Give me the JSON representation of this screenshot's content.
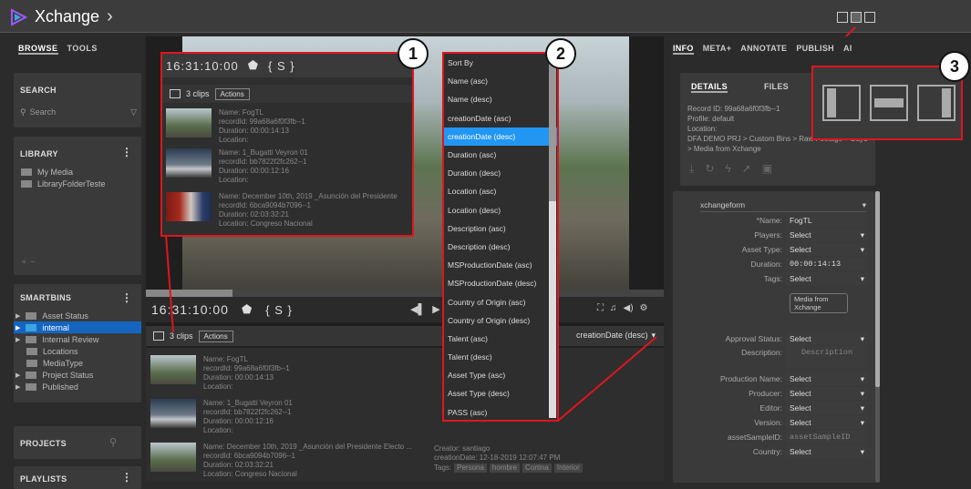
{
  "app": {
    "title": "Xchange"
  },
  "left": {
    "tabs": [
      "BROWSE",
      "TOOLS"
    ],
    "search": {
      "title": "SEARCH",
      "placeholder": "Search"
    },
    "library": {
      "title": "LIBRARY",
      "items": [
        "My Media",
        "LibraryFolderTeste"
      ]
    },
    "smartbins": {
      "title": "SMARTBINS",
      "items": [
        "Asset Status",
        "internal",
        "Internal Review",
        "Locations",
        "MediaType",
        "Project Status",
        "Published"
      ]
    },
    "projects": {
      "title": "PROJECTS"
    },
    "playlists": {
      "title": "PLAYLISTS"
    }
  },
  "player": {
    "timecode": "16:31:10:00",
    "controls": "{ S }"
  },
  "clips": {
    "count": "3 clips",
    "actions": "Actions",
    "sort": "creationDate (desc)",
    "items": [
      {
        "name": "Name: FogTL",
        "id": "recordId: 99a68a6f0f3fb--1",
        "duration": "Duration: 00:00:14:13",
        "location": "Location:"
      },
      {
        "name": "Name: 1_Bugatti Veyron 01",
        "id": "recordId: bb7822f2fc262--1",
        "duration": "Duration: 00:00:12:16",
        "location": "Location:"
      },
      {
        "name": "Name: December 10th, 2019 _Asunción del Presidente Electo ...",
        "id": "recordId: 6bca9094b7096--1",
        "duration": "Duration: 02:03:32:21",
        "location": "Location: Congreso Nacional"
      }
    ],
    "third_meta": {
      "creator": "Creator: santiago",
      "created": "creationDate: 12-18-2019 12:07:47 PM",
      "tags_label": "Tags:",
      "tags": [
        "Persona",
        "hombre",
        "Cortina",
        "Interior"
      ]
    }
  },
  "popup_clips": {
    "items": [
      {
        "name": "Name: FogTL",
        "id": "recordId: 99a68a6f0f3fb--1",
        "duration": "Duration: 00:00:14:13",
        "location": "Location:"
      },
      {
        "name": "Name: 1_Bugatti Veyron 01",
        "id": "recordId: bb7822f2fc262--1",
        "duration": "Duration: 00:00:12:16",
        "location": "Location:"
      },
      {
        "name": "Name: December 10th, 2019 _Asunción del Presidente",
        "id": "recordId: 6bca9094b7096--1",
        "duration": "Duration: 02:03:32:21",
        "location": "Location: Congreso Nacional"
      }
    ]
  },
  "sort_options": [
    "Sort By",
    "Name (asc)",
    "Name (desc)",
    "creationDate (asc)",
    "creationDate (desc)",
    "Duration (asc)",
    "Duration (desc)",
    "Location (asc)",
    "Location (desc)",
    "Description (asc)",
    "Description (desc)",
    "MSProductionDate (asc)",
    "MSProductionDate (desc)",
    "Country of Origin (asc)",
    "Country of Origin (desc)",
    "Talent (asc)",
    "Talent (desc)",
    "Asset Type (asc)",
    "Asset Type (desc)",
    "PASS (asc)"
  ],
  "right": {
    "tabs": [
      "INFO",
      "META+",
      "ANNOTATE",
      "PUBLISH",
      "AI"
    ],
    "details": {
      "tabs": [
        "DETAILS",
        "FILES"
      ],
      "record": "Record ID:  99a68a6f0f3fb--1",
      "profile": "Profile:  default",
      "location": "Location:",
      "path": "DFA DEMO PRJ > Custom Bins > Raw Footage > Day1",
      "path2": "> Media from Xchange"
    },
    "form": {
      "name": "xchangeform",
      "fields": [
        {
          "label": "*Name:",
          "value": "FogTL"
        },
        {
          "label": "Players:",
          "value": "Select"
        },
        {
          "label": "Asset Type:",
          "value": "Select"
        },
        {
          "label": "Duration:",
          "value": "00:00:14:13"
        },
        {
          "label": "Tags:",
          "value": "Select"
        }
      ],
      "tag_chip": "Media from Xchange",
      "fields2": [
        {
          "label": "Approval Status:",
          "value": "Select"
        },
        {
          "label": "Description:",
          "value": "Description"
        },
        {
          "label": "Production Name:",
          "value": "Select"
        },
        {
          "label": "Producer:",
          "value": "Select"
        },
        {
          "label": "Editor:",
          "value": "Select"
        },
        {
          "label": "Version:",
          "value": "Select"
        },
        {
          "label": "assetSampleID:",
          "value": "assetSampleID"
        },
        {
          "label": "Country:",
          "value": "Select"
        }
      ]
    }
  },
  "callouts": [
    "1",
    "2",
    "3"
  ]
}
